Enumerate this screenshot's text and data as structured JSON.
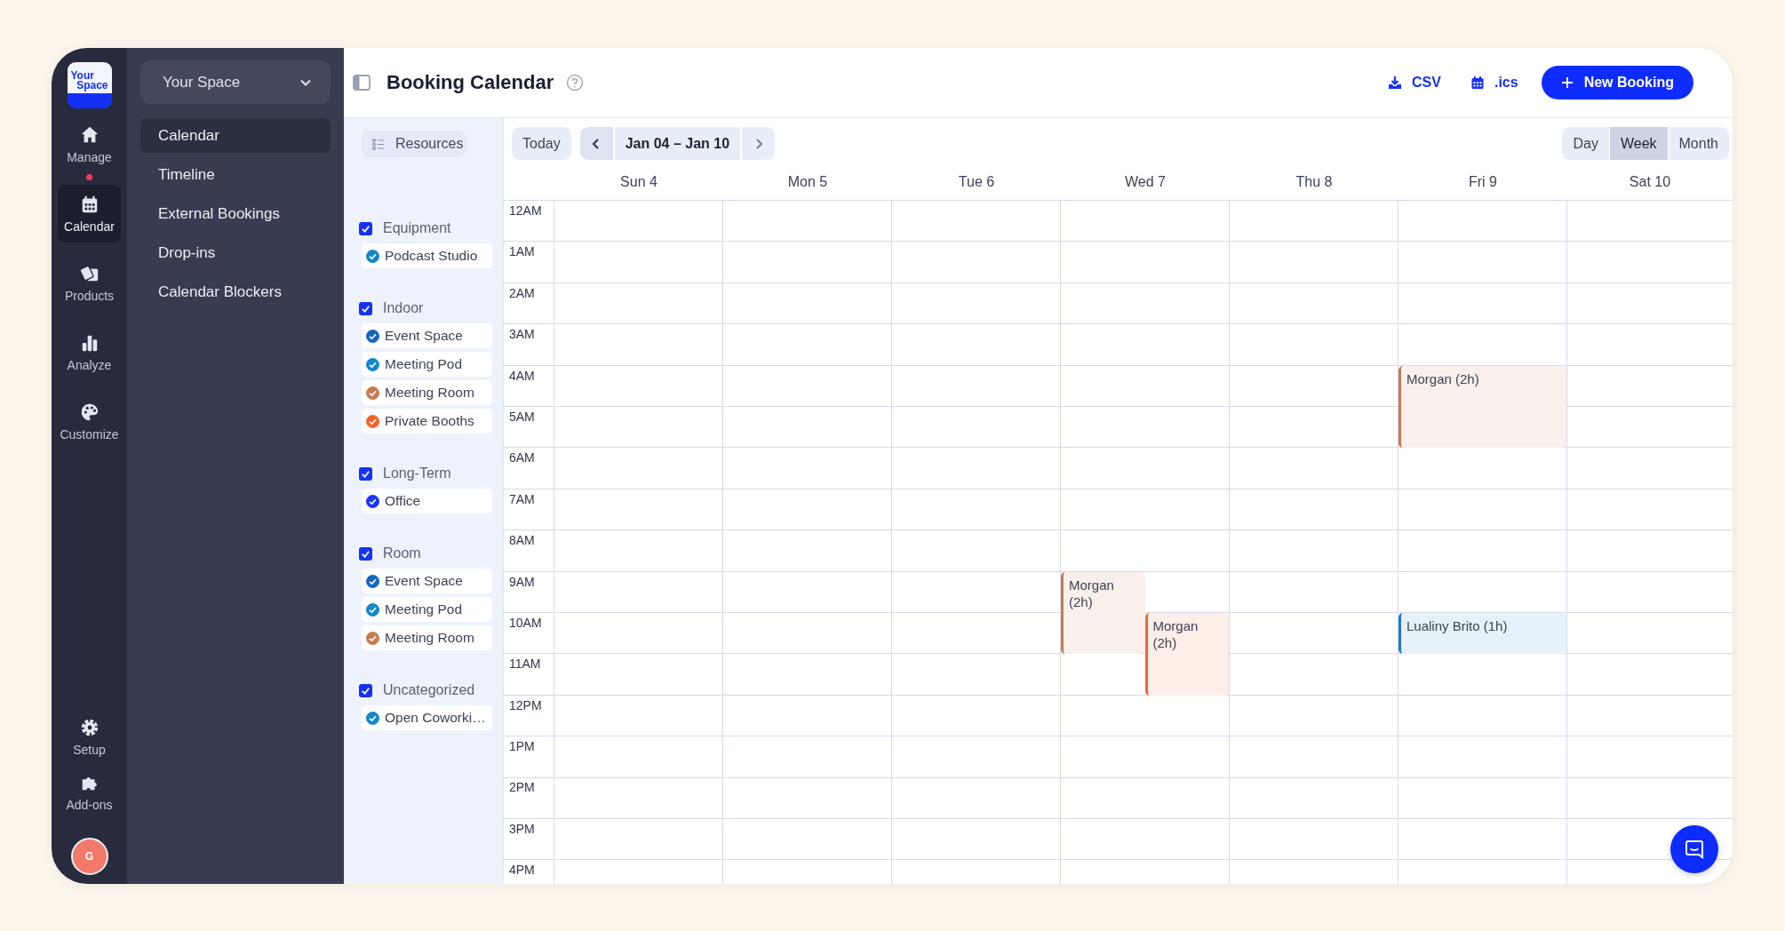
{
  "rail": {
    "logo": [
      "Your",
      "Space"
    ],
    "items": [
      {
        "label": "Manage",
        "selected": false,
        "notification": true
      },
      {
        "label": "Calendar",
        "selected": true,
        "notification": false
      },
      {
        "label": "Products",
        "selected": false,
        "notification": false
      },
      {
        "label": "Analyze",
        "selected": false,
        "notification": false
      },
      {
        "label": "Customize",
        "selected": false,
        "notification": false
      }
    ],
    "bottom_items": [
      {
        "label": "Setup",
        "selected": false
      },
      {
        "label": "Add-ons",
        "selected": false
      }
    ],
    "avatar": "G"
  },
  "subnav": {
    "workspace": "Your Space",
    "items": [
      {
        "label": "Calendar",
        "selected": true
      },
      {
        "label": "Timeline",
        "selected": false
      },
      {
        "label": "External Bookings",
        "selected": false
      },
      {
        "label": "Drop-ins",
        "selected": false
      },
      {
        "label": "Calendar Blockers",
        "selected": false
      }
    ]
  },
  "header": {
    "title": "Booking Calendar",
    "actions": [
      {
        "label": "CSV",
        "kind": "link"
      },
      {
        "label": ".ics",
        "kind": "link"
      },
      {
        "label": "New Booking",
        "kind": "primary"
      }
    ]
  },
  "resources": {
    "button": "Resources",
    "groups": [
      {
        "name": "Equipment",
        "checked": true,
        "items": [
          {
            "name": "Podcast Studio",
            "checked": true,
            "color": "#1388c9"
          }
        ]
      },
      {
        "name": "Indoor",
        "checked": true,
        "items": [
          {
            "name": "Event Space",
            "checked": true,
            "color": "#1565c0"
          },
          {
            "name": "Meeting Pod",
            "checked": true,
            "color": "#1388c9"
          },
          {
            "name": "Meeting Room",
            "checked": true,
            "color": "#c87a4f"
          },
          {
            "name": "Private Booths",
            "checked": true,
            "color": "#f4632b"
          }
        ]
      },
      {
        "name": "Long-Term",
        "checked": true,
        "items": [
          {
            "name": "Office",
            "checked": true,
            "color": "#1a36f5"
          }
        ]
      },
      {
        "name": "Room",
        "checked": true,
        "items": [
          {
            "name": "Event Space",
            "checked": true,
            "color": "#1565c0"
          },
          {
            "name": "Meeting Pod",
            "checked": true,
            "color": "#1388c9"
          },
          {
            "name": "Meeting Room",
            "checked": true,
            "color": "#c87a4f"
          }
        ]
      },
      {
        "name": "Uncategorized",
        "checked": true,
        "items": [
          {
            "name": "Open Coworki…",
            "checked": true,
            "color": "#1388c9"
          }
        ]
      }
    ]
  },
  "calendar": {
    "today": "Today",
    "range": "Jan 04 – Jan 10",
    "views": [
      {
        "label": "Day",
        "selected": false
      },
      {
        "label": "Week",
        "selected": true
      },
      {
        "label": "Month",
        "selected": false
      }
    ],
    "hours": [
      "12AM",
      "1AM",
      "2AM",
      "3AM",
      "4AM",
      "5AM",
      "6AM",
      "7AM",
      "8AM",
      "9AM",
      "10AM",
      "11AM",
      "12PM",
      "1PM",
      "2PM",
      "3PM",
      "4PM"
    ],
    "days": [
      {
        "label": "Sun 4"
      },
      {
        "label": "Mon 5"
      },
      {
        "label": "Tue 6"
      },
      {
        "label": "Wed 7",
        "events": [
          {
            "title": "Morgan (2h)",
            "color": "#c87a4f"
          },
          {
            "title": "Morgan (2h)",
            "color": "#f4632b"
          }
        ]
      },
      {
        "label": "Thu 8"
      },
      {
        "label": "Fri 9",
        "events": [
          {
            "title": "Morgan (2h)",
            "color": "#c87a4f"
          },
          {
            "title": "Lualiny Brito (1h)",
            "color": "#1b7cc4"
          }
        ]
      },
      {
        "label": "Sat 10"
      }
    ]
  }
}
